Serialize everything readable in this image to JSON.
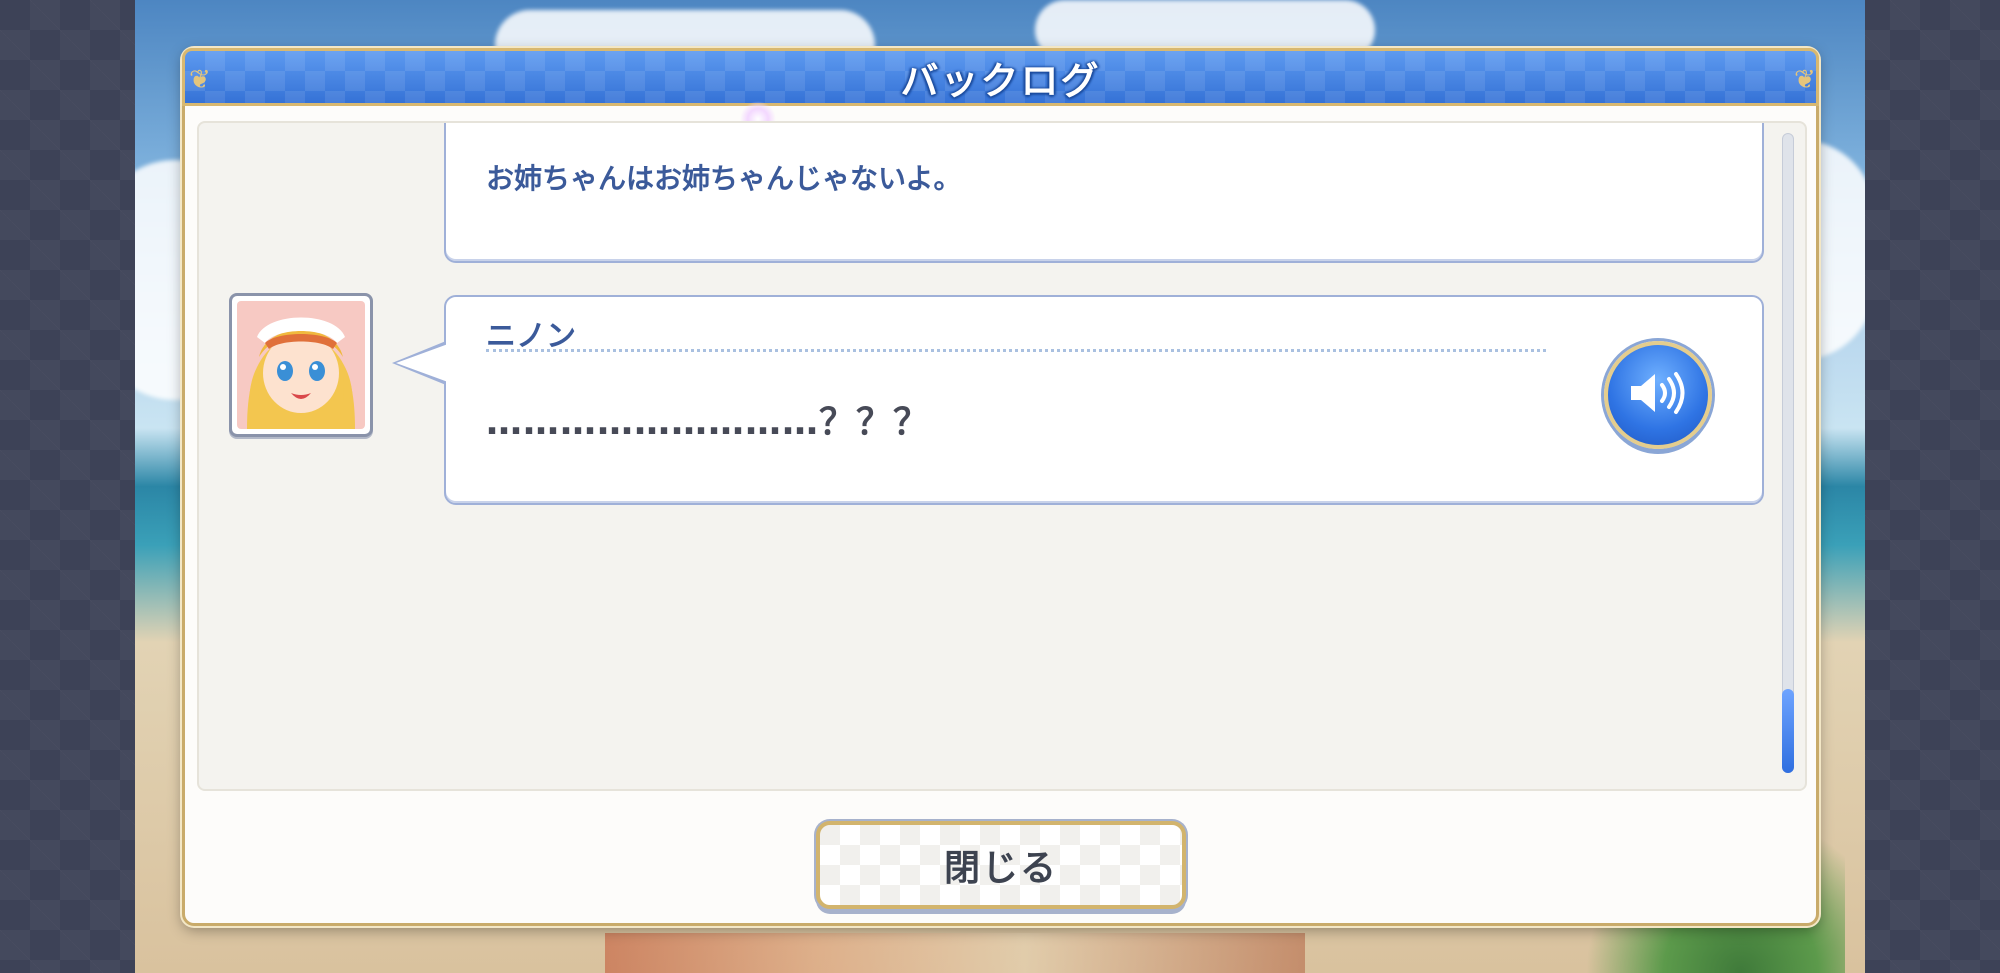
{
  "backlog": {
    "title": "バックログ",
    "entries": [
      {
        "speaker": "",
        "text": "お姉ちゃんはお姉ちゃんじゃないよ。"
      },
      {
        "speaker": "ニノン",
        "text": "………………………？？？",
        "avatar": "ninon-portrait",
        "voice_icon": "speaker-volume-icon"
      }
    ],
    "close_label": "閉じる"
  },
  "colors": {
    "title_bar": "#3e7fe0",
    "frame_gold": "#c9ab6a",
    "name_text": "#3b5a9a",
    "dialogue_text": "#474a57",
    "voice_button": "#2f74e4"
  }
}
